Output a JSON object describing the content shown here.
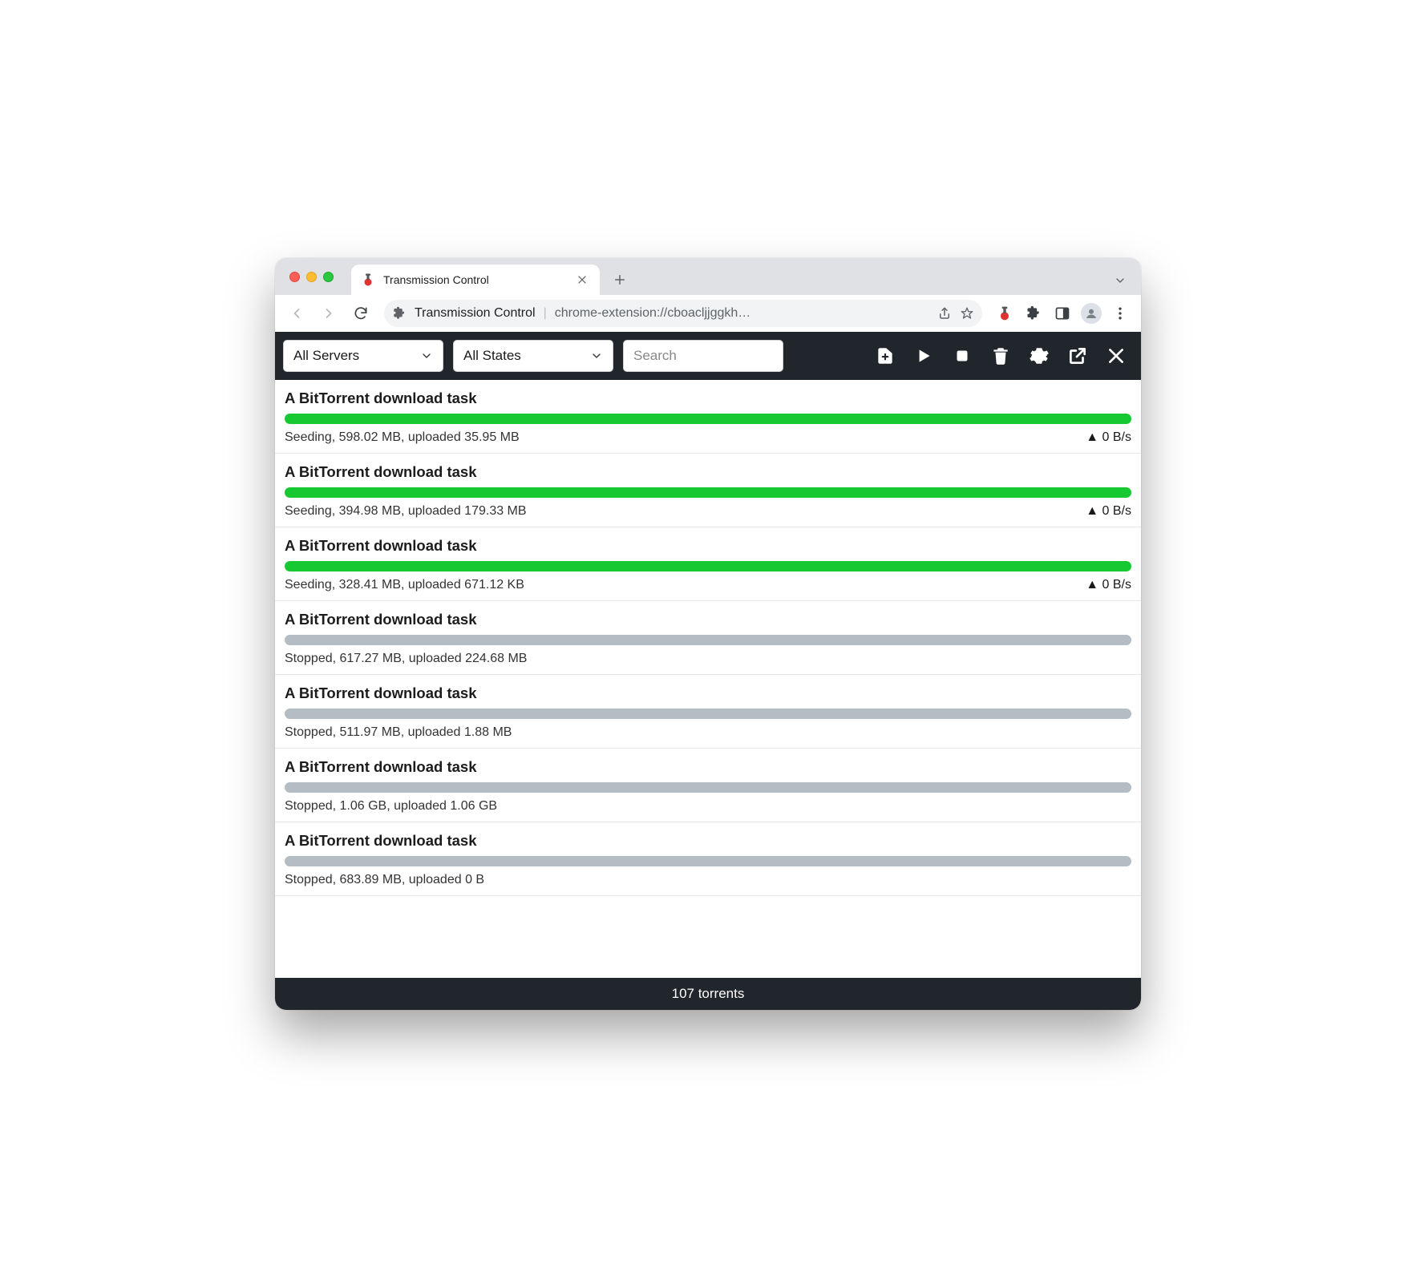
{
  "browser": {
    "tab_title": "Transmission Control",
    "omnibox_label": "Transmission Control",
    "omnibox_url": "chrome-extension://cboacljjggkh…"
  },
  "filters": {
    "server": "All Servers",
    "state": "All States",
    "search_placeholder": "Search"
  },
  "torrents": [
    {
      "title": "A BitTorrent download task",
      "state": "seeding",
      "status": "Seeding, 598.02 MB, uploaded 35.95 MB",
      "speed": "▲ 0 B/s"
    },
    {
      "title": "A BitTorrent download task",
      "state": "seeding",
      "status": "Seeding, 394.98 MB, uploaded 179.33 MB",
      "speed": "▲ 0 B/s"
    },
    {
      "title": "A BitTorrent download task",
      "state": "seeding",
      "status": "Seeding, 328.41 MB, uploaded 671.12 KB",
      "speed": "▲ 0 B/s"
    },
    {
      "title": "A BitTorrent download task",
      "state": "stopped",
      "status": "Stopped, 617.27 MB, uploaded 224.68 MB",
      "speed": ""
    },
    {
      "title": "A BitTorrent download task",
      "state": "stopped",
      "status": "Stopped, 511.97 MB, uploaded 1.88 MB",
      "speed": ""
    },
    {
      "title": "A BitTorrent download task",
      "state": "stopped",
      "status": "Stopped, 1.06 GB, uploaded 1.06 GB",
      "speed": ""
    },
    {
      "title": "A BitTorrent download task",
      "state": "stopped",
      "status": "Stopped, 683.89 MB, uploaded 0 B",
      "speed": ""
    }
  ],
  "footer": "107 torrents"
}
